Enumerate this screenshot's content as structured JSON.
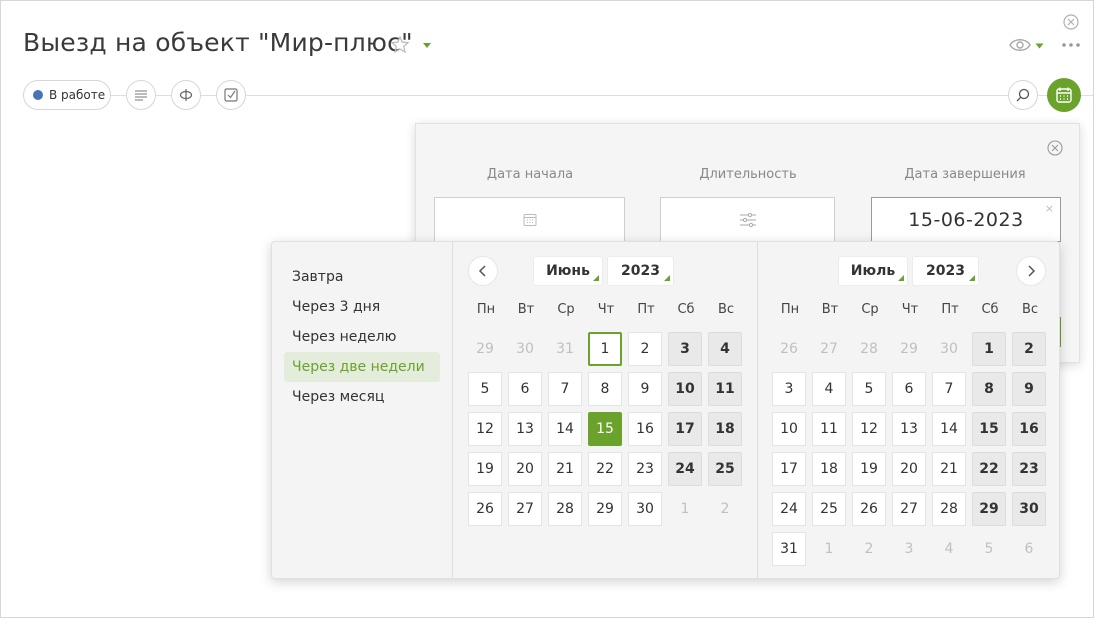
{
  "header": {
    "title": "Выезд на объект \"Мир-плюс\""
  },
  "toolbar": {
    "status_label": "В работе",
    "status_color": "#4a73b5",
    "accent": "#6aa22c"
  },
  "date_panel": {
    "start_label": "Дата начала",
    "duration_label": "Длительность",
    "end_label": "Дата завершения",
    "end_value": "15-06-2023",
    "clear_glyph": "×"
  },
  "presets": [
    {
      "label": "Завтра",
      "active": false
    },
    {
      "label": "Через 3 дня",
      "active": false
    },
    {
      "label": "Через неделю",
      "active": false
    },
    {
      "label": "Через две недели",
      "active": true
    },
    {
      "label": "Через месяц",
      "active": false
    }
  ],
  "weekdays": [
    "Пн",
    "Вт",
    "Ср",
    "Чт",
    "Пт",
    "Сб",
    "Вс"
  ],
  "months": [
    {
      "month_label": "Июнь",
      "year_label": "2023",
      "days": [
        [
          "29",
          "muted"
        ],
        [
          "30",
          "muted"
        ],
        [
          "31",
          "muted"
        ],
        [
          "1",
          "today"
        ],
        [
          "2",
          ""
        ],
        [
          "3",
          "weekend"
        ],
        [
          "4",
          "weekend"
        ],
        [
          "5",
          ""
        ],
        [
          "6",
          ""
        ],
        [
          "7",
          ""
        ],
        [
          "8",
          ""
        ],
        [
          "9",
          ""
        ],
        [
          "10",
          "weekend"
        ],
        [
          "11",
          "weekend"
        ],
        [
          "12",
          ""
        ],
        [
          "13",
          ""
        ],
        [
          "14",
          ""
        ],
        [
          "15",
          "selected"
        ],
        [
          "16",
          ""
        ],
        [
          "17",
          "weekend"
        ],
        [
          "18",
          "weekend"
        ],
        [
          "19",
          ""
        ],
        [
          "20",
          ""
        ],
        [
          "21",
          ""
        ],
        [
          "22",
          ""
        ],
        [
          "23",
          ""
        ],
        [
          "24",
          "weekend"
        ],
        [
          "25",
          "weekend"
        ],
        [
          "26",
          ""
        ],
        [
          "27",
          ""
        ],
        [
          "28",
          ""
        ],
        [
          "29",
          ""
        ],
        [
          "30",
          ""
        ],
        [
          "1",
          "muted"
        ],
        [
          "2",
          "muted"
        ]
      ]
    },
    {
      "month_label": "Июль",
      "year_label": "2023",
      "days": [
        [
          "26",
          "muted"
        ],
        [
          "27",
          "muted"
        ],
        [
          "28",
          "muted"
        ],
        [
          "29",
          "muted"
        ],
        [
          "30",
          "muted"
        ],
        [
          "1",
          "weekend"
        ],
        [
          "2",
          "weekend"
        ],
        [
          "3",
          ""
        ],
        [
          "4",
          ""
        ],
        [
          "5",
          ""
        ],
        [
          "6",
          ""
        ],
        [
          "7",
          ""
        ],
        [
          "8",
          "weekend"
        ],
        [
          "9",
          "weekend"
        ],
        [
          "10",
          ""
        ],
        [
          "11",
          ""
        ],
        [
          "12",
          ""
        ],
        [
          "13",
          ""
        ],
        [
          "14",
          ""
        ],
        [
          "15",
          "weekend"
        ],
        [
          "16",
          "weekend"
        ],
        [
          "17",
          ""
        ],
        [
          "18",
          ""
        ],
        [
          "19",
          ""
        ],
        [
          "20",
          ""
        ],
        [
          "21",
          ""
        ],
        [
          "22",
          "weekend"
        ],
        [
          "23",
          "weekend"
        ],
        [
          "24",
          ""
        ],
        [
          "25",
          ""
        ],
        [
          "26",
          ""
        ],
        [
          "27",
          ""
        ],
        [
          "28",
          ""
        ],
        [
          "29",
          "weekend"
        ],
        [
          "30",
          "weekend"
        ],
        [
          "31",
          ""
        ],
        [
          "1",
          "muted"
        ],
        [
          "2",
          "muted"
        ],
        [
          "3",
          "muted"
        ],
        [
          "4",
          "muted"
        ],
        [
          "5",
          "muted"
        ],
        [
          "6",
          "muted"
        ]
      ]
    }
  ]
}
